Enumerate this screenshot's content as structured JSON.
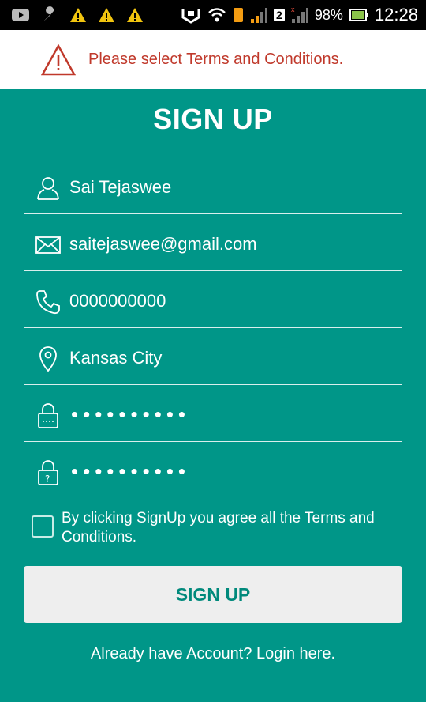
{
  "status_bar": {
    "battery": "98%",
    "time": "12:28",
    "sim_slot": "2",
    "left_icons": [
      "youtube-icon",
      "wrench-icon",
      "warning-icon",
      "warning-icon",
      "warning-icon"
    ],
    "right_icons": [
      "nfc-icon",
      "wifi-icon",
      "sim1-icon",
      "signal-icon",
      "sim2-icon",
      "signal-icon",
      "battery-icon"
    ]
  },
  "banner": {
    "message": "Please select Terms and Conditions.",
    "icon": "warning-triangle-icon",
    "color": "#c0392b"
  },
  "form": {
    "title": "SIGN UP",
    "name": {
      "value": "Sai Tejaswee",
      "icon": "person-icon"
    },
    "email": {
      "value": "saitejaswee@gmail.com",
      "icon": "envelope-icon"
    },
    "phone": {
      "value": "0000000000",
      "icon": "phone-icon"
    },
    "city": {
      "value": "Kansas City",
      "icon": "location-pin-icon"
    },
    "password": {
      "masked": "••••••••••",
      "icon": "lock-icon"
    },
    "confirm_password": {
      "masked": "••••••••••",
      "icon": "lock-question-icon"
    },
    "terms_checkbox": {
      "checked": false,
      "label": "By clicking SignUp you agree all the Terms and Conditions."
    },
    "signup_button": "SIGN UP",
    "login_link": "Already have Account? Login here."
  },
  "colors": {
    "background": "#009688",
    "accent_text": "#00897b",
    "error": "#c0392b"
  }
}
